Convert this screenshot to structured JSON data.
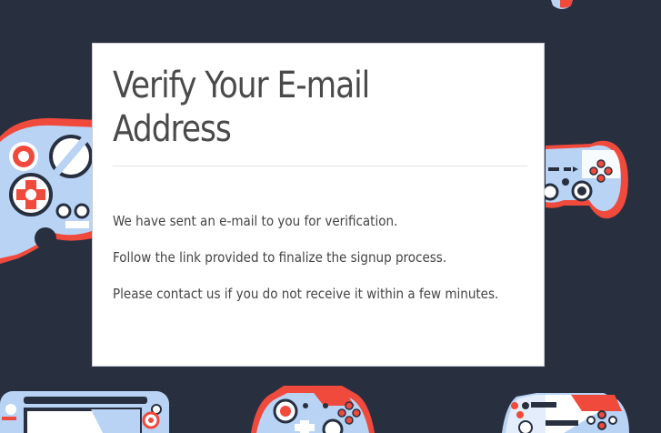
{
  "page": {
    "background_color": "#283040",
    "pattern_colors": {
      "light_blue": "#b9d3f5",
      "red": "#f04a3c",
      "dark": "#283040",
      "white": "#ffffff"
    }
  },
  "card": {
    "title": "Verify Your E-mail Address",
    "messages": [
      "We have sent an e-mail to you for verification.",
      "Follow the link provided to finalize the signup process.",
      "Please contact us if you do not receive it within a few minutes."
    ]
  },
  "background_icons": [
    "game-controller-icon",
    "gamepad-icon",
    "handheld-console-icon"
  ]
}
